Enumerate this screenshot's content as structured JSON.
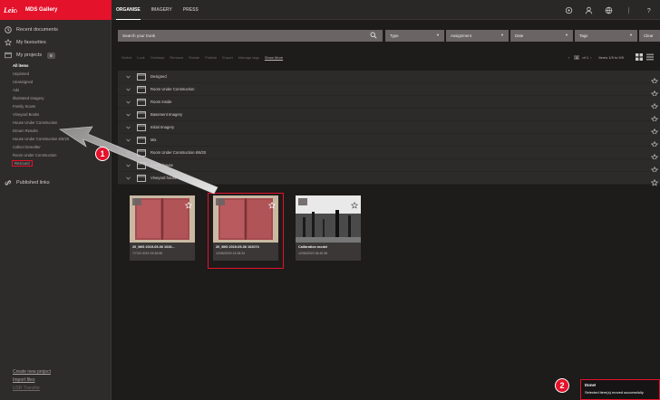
{
  "brand": {
    "name": "MDS Gallery",
    "color": "#e4122b"
  },
  "sidebar": {
    "recent": "Recent documents",
    "favourites": "My favourites",
    "projects": {
      "label": "My projects",
      "count": "8"
    },
    "project_items": [
      "All items",
      "Unpinned",
      "Unassigned",
      "Ads",
      "Illustrated Imagery",
      "Family Scans",
      "Vineyard Books",
      "House Under Construction",
      "Dream Results",
      "House Under Construction 6/6/20",
      "Collect hereafter",
      "Room Under Construction",
      "Rescued"
    ],
    "published": "Published links",
    "bottom": {
      "create": "Create new project",
      "import": "Import files",
      "transfer": "USB Transfer"
    }
  },
  "topbar": {
    "tabs": [
      "ORGANISE",
      "IMAGERY",
      "PRESS"
    ],
    "icons": [
      "settings-icon",
      "user-icon",
      "globe-icon",
      "more-icon",
      "info-icon"
    ]
  },
  "search": {
    "placeholder": "Search your trunk"
  },
  "filters": [
    {
      "label": "Type"
    },
    {
      "label": "Assignment"
    },
    {
      "label": "Date"
    },
    {
      "label": "Tags"
    },
    {
      "label": "Clear"
    }
  ],
  "toolbar": {
    "actions": [
      "Select",
      "Lock",
      "Overlays",
      "Remove",
      "Rotate",
      "Publish",
      "Export",
      "Manage tags"
    ],
    "show_more": "Show More",
    "pager": {
      "page": "1",
      "of": "of 1",
      "summary": "Items 1/9 to 9/9"
    }
  },
  "folders": [
    "Designed",
    "Room Under Construction",
    "Room Inside",
    "Basement Imagery",
    "Initial Imagery",
    "Mix",
    "Room Under Construction 6/6/20",
    "Family house",
    "Vineyard house"
  ],
  "thumbs": [
    {
      "name": "20_IMG 2019-05-06 1026...",
      "date": "7/7/24 2019 19:26:56"
    },
    {
      "name": "20_IMG 2019-05-06 102074",
      "date": "12/06/2023 13:28:24"
    },
    {
      "name": "Calibration model",
      "date": "12/06/2023 18:40:36"
    }
  ],
  "callouts": [
    "1",
    "2"
  ],
  "toast": {
    "title": "Done!",
    "message": "Selected item(s) moved successfully"
  }
}
